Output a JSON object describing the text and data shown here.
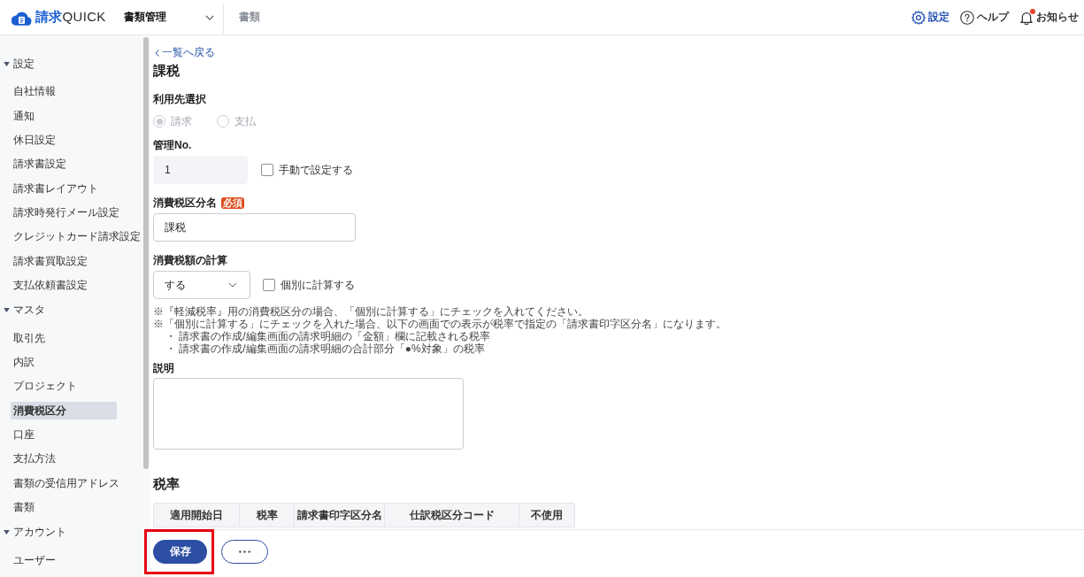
{
  "header": {
    "logo": {
      "mark": "請求",
      "name": "QUICK"
    },
    "module_switcher": {
      "label": "書類管理"
    },
    "nav": [
      {
        "label": "書類",
        "selected": false
      }
    ],
    "links": [
      {
        "kind": "settings",
        "label": "設定",
        "selected": true
      },
      {
        "kind": "help",
        "label": "ヘルプ",
        "selected": false
      },
      {
        "kind": "notifications",
        "label": "お知らせ",
        "selected": false,
        "unread": true
      }
    ]
  },
  "sidebar": {
    "sections": [
      {
        "label": "設定",
        "expanded": true,
        "items": [
          {
            "label": "自社情報",
            "selected": false
          },
          {
            "label": "通知",
            "selected": false
          },
          {
            "label": "休日設定",
            "selected": false
          },
          {
            "label": "請求書設定",
            "selected": false
          },
          {
            "label": "請求書レイアウト",
            "selected": false
          },
          {
            "label": "請求時発行メール設定",
            "selected": false
          },
          {
            "label": "クレジットカード請求設定",
            "selected": false
          },
          {
            "label": "請求書買取設定",
            "selected": false
          },
          {
            "label": "支払依頼書設定",
            "selected": false
          }
        ]
      },
      {
        "label": "マスタ",
        "expanded": true,
        "items": [
          {
            "label": "取引先",
            "selected": false
          },
          {
            "label": "内訳",
            "selected": false
          },
          {
            "label": "プロジェクト",
            "selected": false
          },
          {
            "label": "消費税区分",
            "selected": true
          },
          {
            "label": "口座",
            "selected": false
          },
          {
            "label": "支払方法",
            "selected": false
          },
          {
            "label": "書類の受信用アドレス",
            "selected": false
          },
          {
            "label": "書類",
            "selected": false
          }
        ]
      },
      {
        "label": "アカウント",
        "expanded": true,
        "items": [
          {
            "label": "ユーザー",
            "selected": false
          }
        ]
      }
    ]
  },
  "page": {
    "back_link": "一覧へ戻る",
    "title": "課税",
    "usage": {
      "label": "利用先選択",
      "disabled": true,
      "options": [
        {
          "label": "請求",
          "selected": true
        },
        {
          "label": "支払",
          "selected": false
        }
      ]
    },
    "management_no": {
      "label": "管理No.",
      "value": "1",
      "disabled": true,
      "manual": {
        "label": "手動で設定する",
        "checked": false
      }
    },
    "tax_category_name": {
      "label": "消費税区分名",
      "badge": "必須",
      "value": "課税"
    },
    "tax_calculation": {
      "label": "消費税額の計算",
      "value": "する",
      "individual": {
        "label": "個別に計算する",
        "checked": false
      }
    },
    "notes": [
      {
        "text": "※『軽減税率』用の消費税区分の場合、「個別に計算する」にチェックを入れてください。"
      },
      {
        "text": "※「個別に計算する」にチェックを入れた場合、以下の画面での表示が税率で指定の「請求書印字区分名」になります。",
        "children": [
          {
            "text": "・ 請求書の作成/編集画面の請求明細の「金額」欄に記載される税率"
          },
          {
            "text": "・ 請求書の作成/編集画面の請求明細の合計部分「●%対象」の税率"
          }
        ]
      }
    ],
    "description": {
      "label": "説明"
    },
    "tax_rates": {
      "title": "税率",
      "columns": [
        "適用開始日",
        "税率",
        "請求書印字区分名",
        "仕訳税区分コード",
        "不使用"
      ]
    }
  },
  "footer": {
    "buttons": [
      {
        "kind": "primary",
        "label": "保存",
        "highlighted": true
      },
      {
        "kind": "more",
        "highlighted": false
      }
    ]
  }
}
